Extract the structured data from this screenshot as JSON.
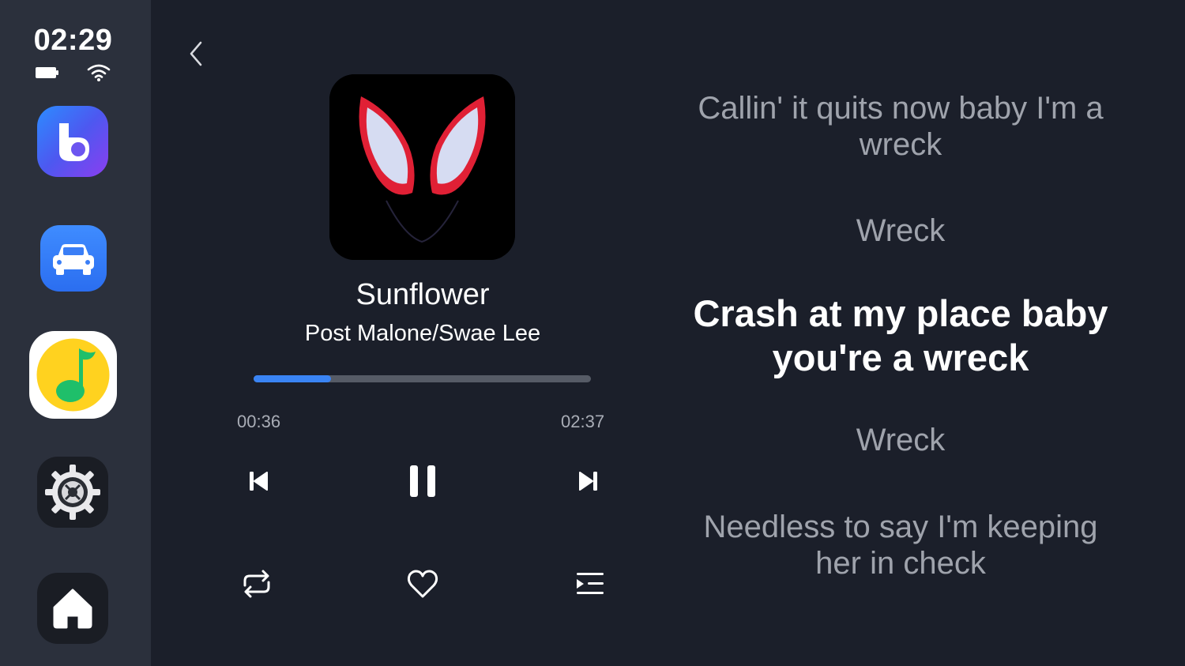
{
  "status": {
    "time": "02:29"
  },
  "sidebar": {
    "apps": [
      "bixby-app",
      "car-app",
      "qq-music-app",
      "settings-app",
      "home"
    ]
  },
  "player": {
    "title": "Sunflower",
    "artist": "Post Malone/Swae Lee",
    "elapsed": "00:36",
    "duration": "02:37",
    "progress_fraction": 0.23,
    "accent_color": "#3a84f4"
  },
  "lyrics": {
    "lines": [
      "Callin' it quits now baby I'm a wreck",
      "Wreck",
      "Crash at my place baby you're a wreck",
      "Wreck",
      "Needless to say I'm keeping her in check"
    ],
    "active_index": 2
  }
}
